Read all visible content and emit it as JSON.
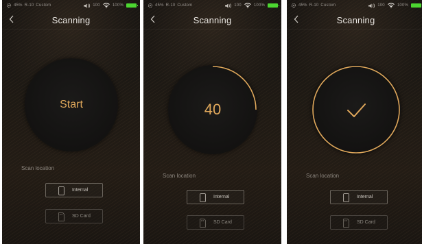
{
  "colors": {
    "accent": "#e0a85b",
    "battery": "#4cd631"
  },
  "panels": [
    {
      "status": {
        "battery_pct": "45%",
        "mode": "R-10",
        "profile": "Custom",
        "volume": "100",
        "wifi_pct": "100%"
      },
      "header": {
        "title": "Scanning"
      },
      "dial": {
        "state": "start",
        "text": "Start",
        "progress": 0
      },
      "scan_location_label": "Scan location",
      "options": [
        {
          "label": "Internal",
          "icon": "phone-icon"
        },
        {
          "label": "SD Card",
          "icon": "sd-card-icon"
        }
      ]
    },
    {
      "status": {
        "battery_pct": "45%",
        "mode": "R-10",
        "profile": "Custom",
        "volume": "100",
        "wifi_pct": "100%"
      },
      "header": {
        "title": "Scanning"
      },
      "dial": {
        "state": "progress",
        "text": "40",
        "progress": 0.25
      },
      "scan_location_label": "Scan location",
      "options": [
        {
          "label": "Internal",
          "icon": "phone-icon"
        },
        {
          "label": "SD Card",
          "icon": "sd-card-icon"
        }
      ]
    },
    {
      "status": {
        "battery_pct": "45%",
        "mode": "R-10",
        "profile": "Custom",
        "volume": "100",
        "wifi_pct": "100%"
      },
      "header": {
        "title": "Scanning"
      },
      "dial": {
        "state": "done",
        "text": "",
        "progress": 1
      },
      "scan_location_label": "Scan location",
      "options": [
        {
          "label": "Internal",
          "icon": "phone-icon"
        },
        {
          "label": "SD Card",
          "icon": "sd-card-icon"
        }
      ]
    }
  ]
}
